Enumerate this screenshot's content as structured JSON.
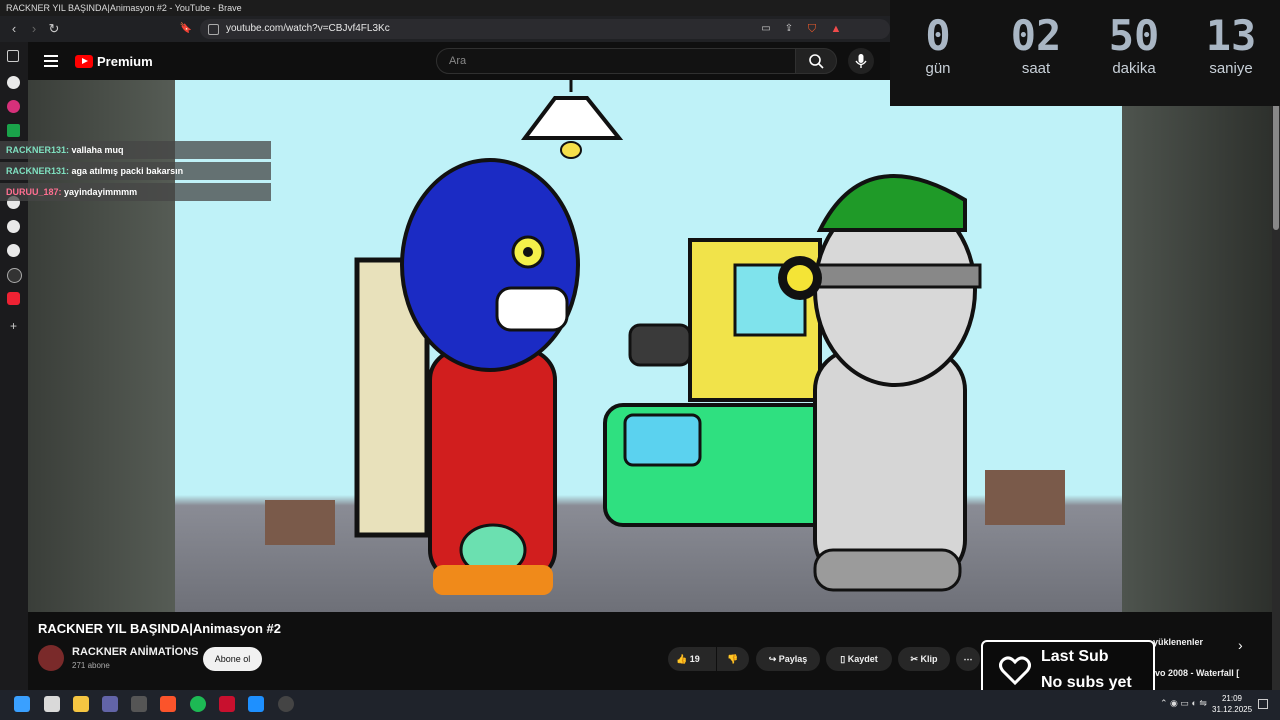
{
  "window": {
    "title": "RACKNER YIL BAŞINDA|Animasyon #2 - YouTube - Brave"
  },
  "address": {
    "url": "youtube.com/watch?v=CBJvf4FL3Kc"
  },
  "youtube": {
    "logo": "Premium",
    "search_placeholder": "Ara"
  },
  "chat": [
    {
      "user": "RACKNER131:",
      "message": "vallaha muq",
      "color": "#7fe0c0"
    },
    {
      "user": "RACKNER131:",
      "message": "aga atılmış packi bakarsın",
      "color": "#7fe0c0"
    },
    {
      "user": "DURUU_187:",
      "message": "yayindayimmmm",
      "color": "#ff6f91"
    }
  ],
  "countdown": [
    {
      "value": "0",
      "label": "gün"
    },
    {
      "value": "02",
      "label": "saat"
    },
    {
      "value": "50",
      "label": "dakika"
    },
    {
      "value": "13",
      "label": "saniye"
    }
  ],
  "video": {
    "title": "RACKNER YIL BAŞINDA|Animasyon #2",
    "channel": "RACKNER ANİMATİONS",
    "subscribers": "271 abone",
    "subscribe_label": "Abone ol",
    "likes": "19",
    "share_label": "Paylaş",
    "save_label": "Kaydet",
    "clip_label": "Klip"
  },
  "related": {
    "chip": "en yüklenenler",
    "item": "vo 2008 - Waterfall ["
  },
  "overlay": {
    "line1": "Last Sub",
    "line2": "No subs yet"
  },
  "taskbar": {
    "time": "21:09",
    "date": "31.12.2025"
  },
  "colors": {
    "accent": "#ff0000",
    "background": "#0f0f0f"
  }
}
